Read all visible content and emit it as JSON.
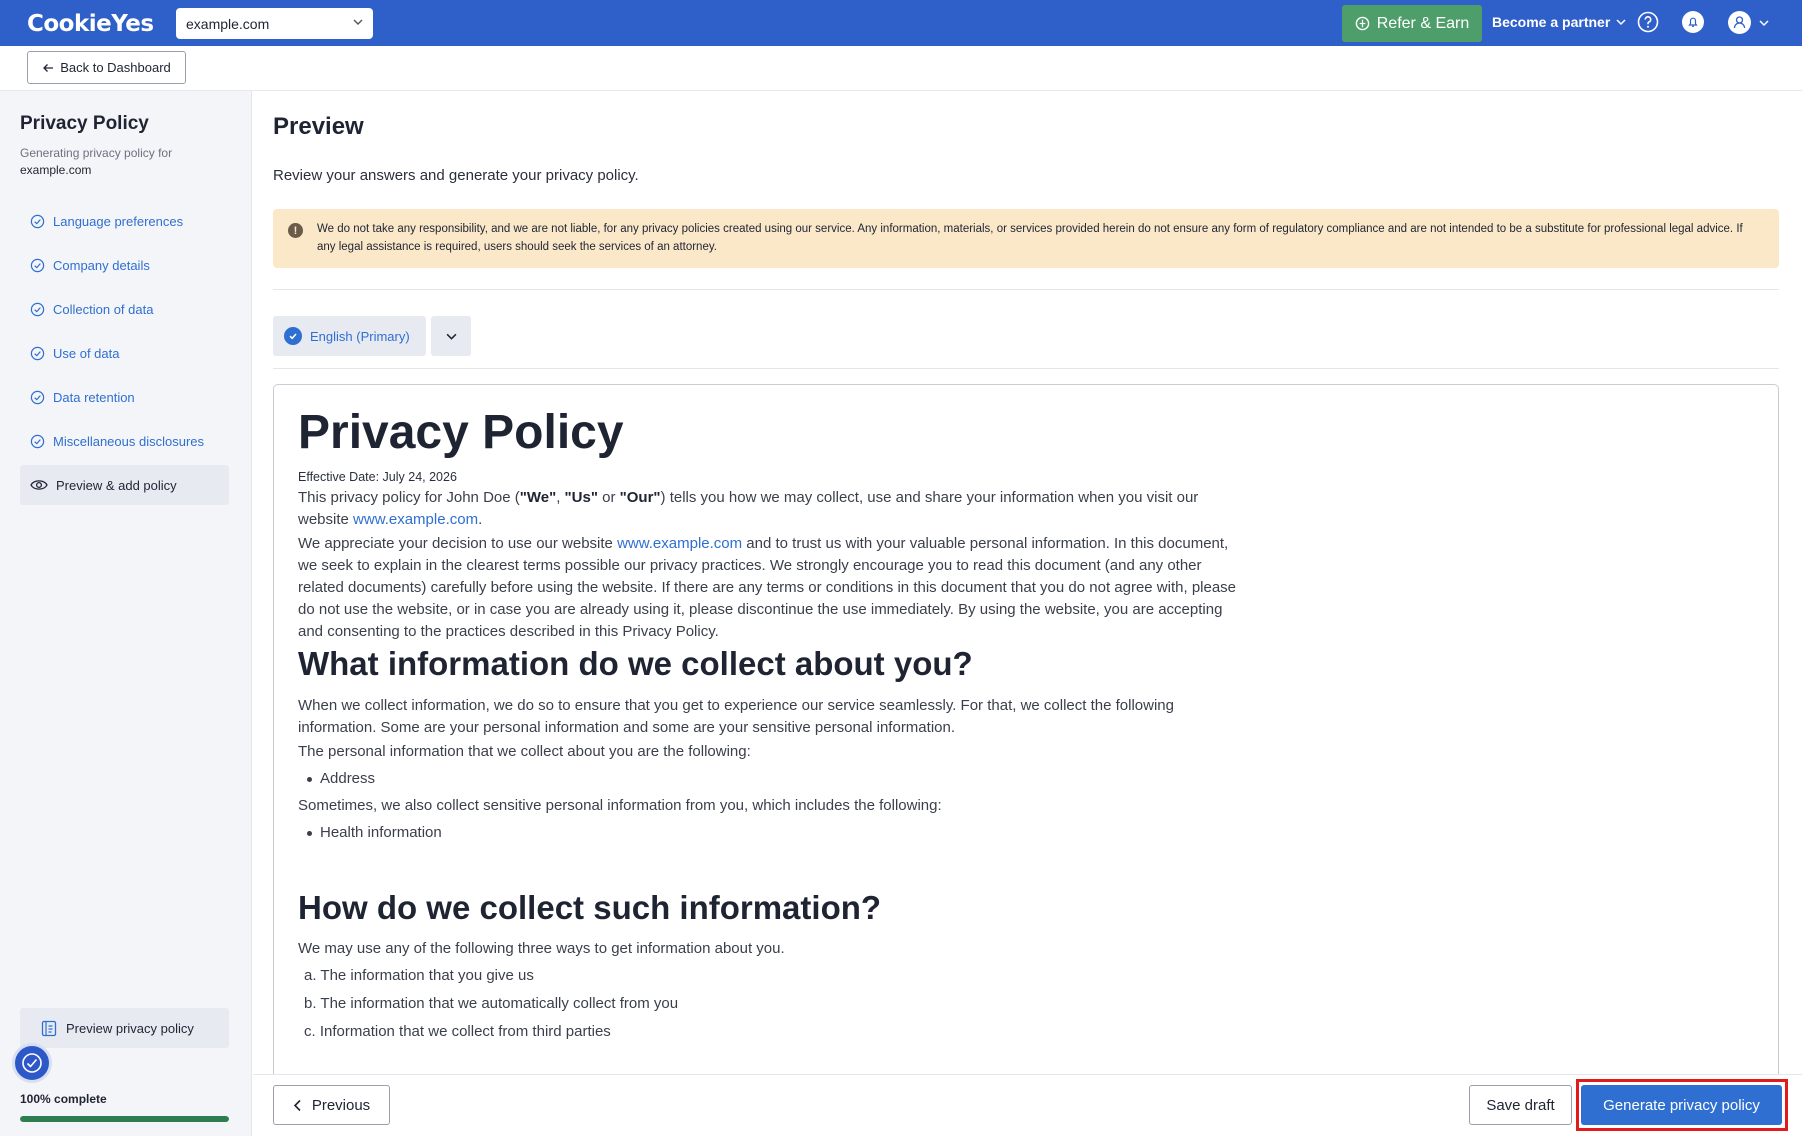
{
  "topbar": {
    "logo": "CookieYes",
    "site_select": "example.com",
    "refer_label": "Refer & Earn",
    "partner_label": "Become a partner"
  },
  "subbar": {
    "back_label": "Back to Dashboard"
  },
  "sidebar": {
    "title": "Privacy Policy",
    "subtitle": "Generating privacy policy for",
    "domain": "example.com",
    "items": [
      {
        "label": "Language preferences",
        "icon": "check-circle-icon"
      },
      {
        "label": "Company details",
        "icon": "check-circle-icon"
      },
      {
        "label": "Collection of data",
        "icon": "check-circle-icon"
      },
      {
        "label": "Use of data",
        "icon": "check-circle-icon"
      },
      {
        "label": "Data retention",
        "icon": "check-circle-icon"
      },
      {
        "label": "Miscellaneous disclosures",
        "icon": "check-circle-icon"
      },
      {
        "label": "Preview & add policy",
        "icon": "eye-icon",
        "active": true
      }
    ],
    "preview_button": "Preview privacy policy",
    "progress_label": "100% complete",
    "progress_value": 100
  },
  "main": {
    "title": "Preview",
    "subtitle": "Review your answers and generate your privacy policy.",
    "warning": "We do not take any responsibility, and we are not liable, for any privacy policies created using our service. Any information, materials, or services provided herein do not ensure any form of regulatory compliance and are not intended to be a substitute for professional legal advice. If any legal assistance is required, users should seek the services of an attorney.",
    "language_label": "English (Primary)"
  },
  "doc": {
    "title": "Privacy Policy",
    "effective_date": "Effective Date: July 24, 2026",
    "p1_a": "This privacy policy for John Doe (",
    "p1_we": "\"We\"",
    "p1_comma1": ", ",
    "p1_us": "\"Us\"",
    "p1_or": " or ",
    "p1_our": "\"Our\"",
    "p1_b": ") tells you how we may collect, use and share your information when you visit our website ",
    "p1_link": "www.example.com",
    "p1_end": ".",
    "p2_a": "We appreciate your decision to use our website ",
    "p2_link": "www.example.com",
    "p2_b": " and to trust us with your valuable personal information. In this document, we seek to explain in the clearest terms possible our privacy practices. We strongly encourage you to read this document (and any other related documents) carefully before using the website. If there are any terms or conditions in this document that you do not agree with, please do not use the website, or in case you are already using it, please discontinue the use immediately. By using the website, you are accepting and consenting to the practices described in this Privacy Policy.",
    "h2_collect": "What information do we collect about you?",
    "p3": "When we collect information, we do so to ensure that you get to experience our service seamlessly. For that, we collect the following information. Some are your personal information and some are your sensitive personal information.",
    "p4": "The personal information that we collect about you are the following:",
    "personal_items": [
      "Address"
    ],
    "p5": "Sometimes, we also collect sensitive personal information from you, which includes the following:",
    "sensitive_items": [
      "Health information"
    ],
    "h2_how": "How do we collect such information?",
    "p6": "We may use any of the following three ways to get information about you.",
    "ways": [
      {
        "marker": "a.",
        "text": "The information that you give us"
      },
      {
        "marker": "b.",
        "text": "The information that we automatically collect from you"
      },
      {
        "marker": "c.",
        "text": "Information that we collect from third parties"
      }
    ]
  },
  "footer": {
    "previous_label": "Previous",
    "save_label": "Save draft",
    "generate_label": "Generate privacy policy"
  },
  "colors": {
    "brand": "#2f5fc9",
    "accent": "#2f6fd1",
    "refer": "#4e9e6b",
    "progress": "#2e7d4f",
    "warning_bg": "#fbe8c8",
    "highlight": "#e11b1b"
  }
}
